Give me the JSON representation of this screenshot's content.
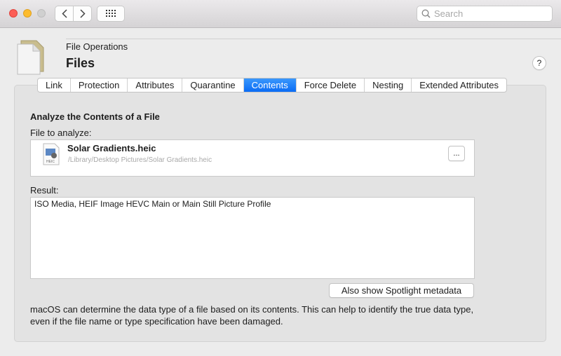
{
  "toolbar": {
    "back_icon": "chevron-left-icon",
    "forward_icon": "chevron-right-icon",
    "grid_icon": "grid-icon",
    "search_placeholder": "Search"
  },
  "header": {
    "subtitle": "File Operations",
    "title": "Files",
    "help_label": "?"
  },
  "tabs": [
    {
      "label": "Link",
      "active": false
    },
    {
      "label": "Protection",
      "active": false
    },
    {
      "label": "Attributes",
      "active": false
    },
    {
      "label": "Quarantine",
      "active": false
    },
    {
      "label": "Contents",
      "active": true
    },
    {
      "label": "Force Delete",
      "active": false
    },
    {
      "label": "Nesting",
      "active": false
    },
    {
      "label": "Extended Attributes",
      "active": false
    }
  ],
  "main": {
    "heading": "Analyze the Contents of a File",
    "file_label": "File to analyze:",
    "file": {
      "name": "Solar Gradients.heic",
      "path": "/Library/Desktop Pictures/Solar Gradients.heic",
      "icon_badge": "HEIC",
      "browse_label": "..."
    },
    "result_label": "Result:",
    "result_value": "ISO Media, HEIF Image HEVC Main or Main Still Picture Profile",
    "spotlight_button": "Also show Spotlight metadata",
    "description": "macOS can determine the data type of a file based on its contents. This can help to identify the true data type, even if the file name or type specification have been damaged."
  },
  "colors": {
    "accent": "#0a6cf5",
    "close": "#fc5f57",
    "minimize": "#fdbc2e",
    "zoom_inactive": "#d0d0d0"
  }
}
